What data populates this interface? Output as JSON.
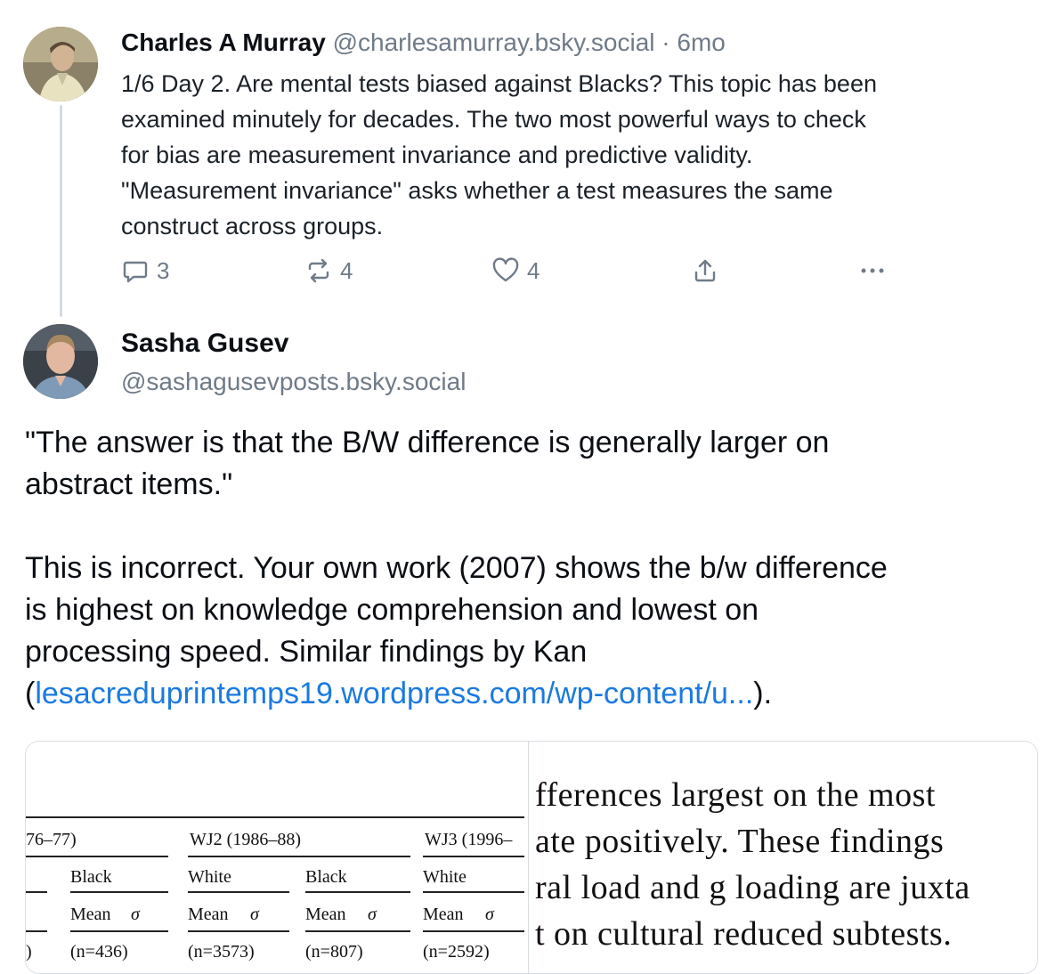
{
  "post1": {
    "author_name": "Charles A Murray",
    "handle": "@charlesamurray.bsky.social",
    "separator": "·",
    "time": "6mo",
    "text_lines": [
      "1/6 Day 2. Are mental tests biased against Blacks? This topic has been",
      "examined minutely for decades. The two most powerful ways to check",
      "for bias are measurement invariance and predictive validity.",
      "\"Measurement invariance\" asks whether a test measures the same",
      "construct across groups."
    ],
    "actions": {
      "reply_count": "3",
      "repost_count": "4",
      "like_count": "4"
    }
  },
  "post2": {
    "author_name": "Sasha Gusev",
    "handle": "@sashagusevposts.bsky.social",
    "para1_lines": [
      "\"The answer is that the B/W difference is generally larger on",
      "abstract items.\""
    ],
    "para2_lines": [
      "This is incorrect. Your own work (2007) shows the b/w difference",
      "is highest on knowledge comprehension and lowest on",
      "processing speed. Similar findings by Kan"
    ],
    "link_open": "(",
    "link_text": "lesacreduprintemps19.wordpress.com/wp-content/u...",
    "link_close": ")."
  },
  "attached_images": {
    "left_table": {
      "col_group_1": "76–77)",
      "col_group_2": "WJ2 (1986–88)",
      "col_group_3": "WJ3 (1996–",
      "row_labels": [
        "Black",
        "White",
        "Black",
        "White"
      ],
      "stat_labels": [
        "Mean",
        "σ",
        "Mean",
        "σ",
        "Mean",
        "σ",
        "Mean",
        "σ"
      ],
      "n_values": [
        ")",
        "(n=436)",
        "(n=3573)",
        "(n=807)",
        "(n=2592)"
      ]
    },
    "right_text_lines": [
      "fferences largest on the most",
      "ate positively. These findings",
      "ral load and g loading are juxta",
      "t on cultural reduced subtests."
    ]
  }
}
